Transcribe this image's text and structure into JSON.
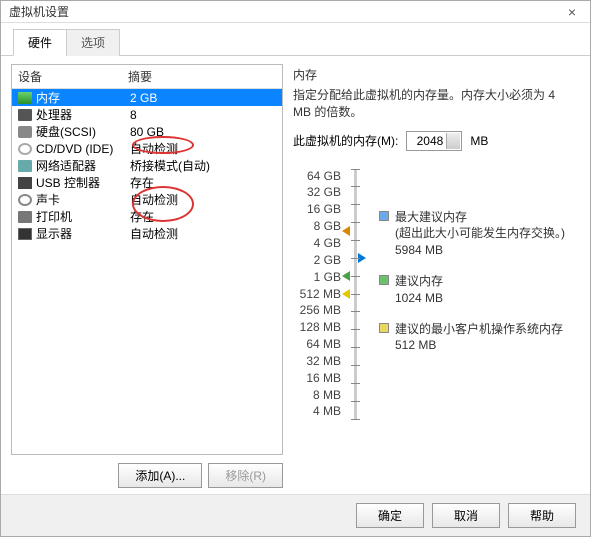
{
  "title": "虚拟机设置",
  "tabs": {
    "hardware": "硬件",
    "options": "选项"
  },
  "list_header": {
    "device": "设备",
    "summary": "摘要"
  },
  "devices": [
    {
      "name": "内存",
      "summary": "2 GB",
      "icon": "icon-mem",
      "selected": true
    },
    {
      "name": "处理器",
      "summary": "8",
      "icon": "icon-cpu"
    },
    {
      "name": "硬盘(SCSI)",
      "summary": "80 GB",
      "icon": "icon-hd"
    },
    {
      "name": "CD/DVD (IDE)",
      "summary": "自动检测",
      "icon": "icon-cd"
    },
    {
      "name": "网络适配器",
      "summary": "桥接模式(自动)",
      "icon": "icon-net"
    },
    {
      "name": "USB 控制器",
      "summary": "存在",
      "icon": "icon-usb"
    },
    {
      "name": "声卡",
      "summary": "自动检测",
      "icon": "icon-snd"
    },
    {
      "name": "打印机",
      "summary": "存在",
      "icon": "icon-prn"
    },
    {
      "name": "显示器",
      "summary": "自动检测",
      "icon": "icon-disp"
    }
  ],
  "left_buttons": {
    "add": "添加(A)...",
    "remove": "移除(R)"
  },
  "memory": {
    "title": "内存",
    "desc": "指定分配给此虚拟机的内存量。内存大小必须为 4 MB 的倍数。",
    "label": "此虚拟机的内存(M):",
    "value": "2048",
    "unit": "MB"
  },
  "ticks": [
    "64 GB",
    "32 GB",
    "16 GB",
    "8 GB",
    "4 GB",
    "2 GB",
    "1 GB",
    "512 MB",
    "256 MB",
    "128 MB",
    "64 MB",
    "32 MB",
    "16 MB",
    "8 MB",
    "4 MB"
  ],
  "legend": {
    "max_rec": {
      "label": "最大建议内存",
      "note": "(超出此大小可能发生内存交换。)",
      "value": "5984 MB"
    },
    "rec": {
      "label": "建议内存",
      "value": "1024 MB"
    },
    "min_rec": {
      "label": "建议的最小客户机操作系统内存",
      "value": "512 MB"
    }
  },
  "dialog_buttons": {
    "ok": "确定",
    "cancel": "取消",
    "help": "帮助"
  }
}
